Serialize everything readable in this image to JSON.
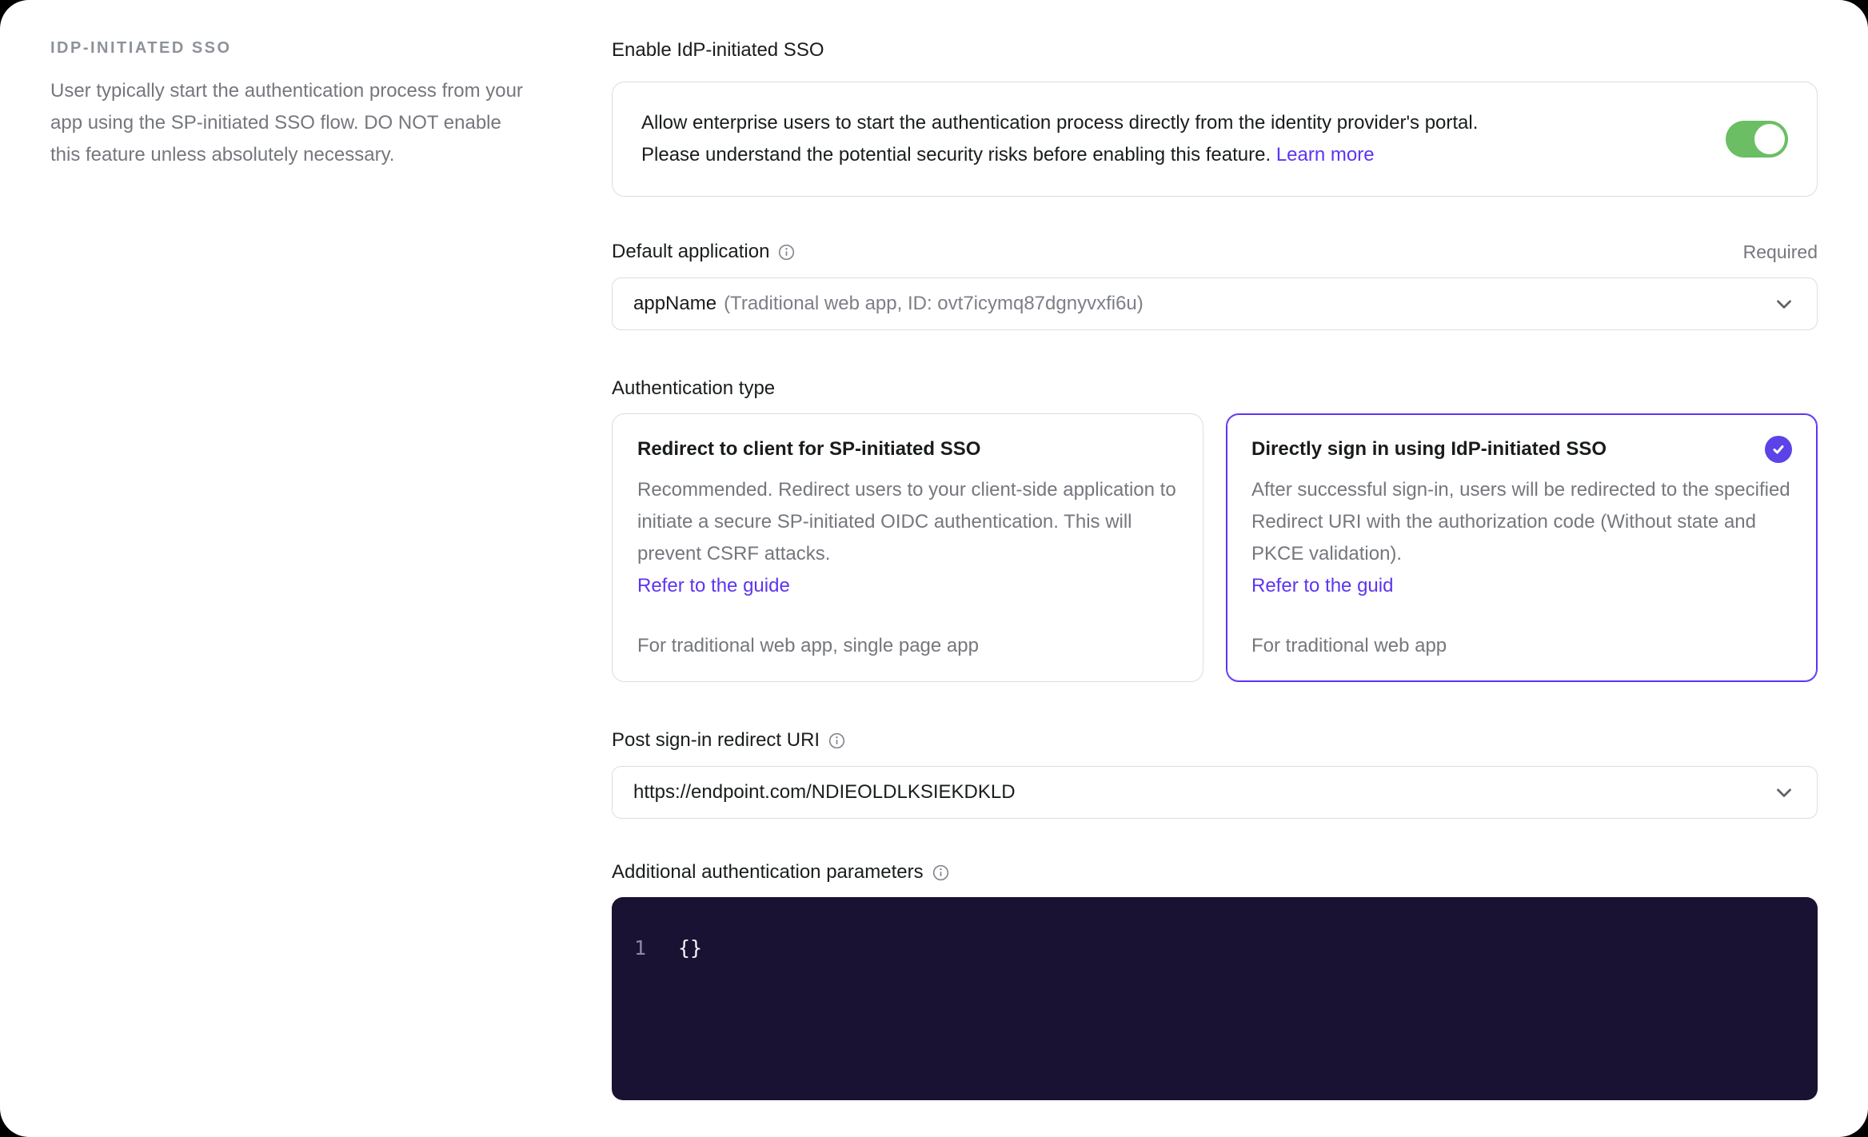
{
  "colors": {
    "accent": "#5d34f2",
    "toggle_on_green": "#6bbe64",
    "editor_background": "#1a1233",
    "muted_text": "#75777d",
    "border": "#dbdde2"
  },
  "icons": {
    "info": "info-circle-outline",
    "chevron": "chevron-down",
    "check": "checkmark"
  },
  "sidebar": {
    "title": "IDP-INITIATED SSO",
    "description": "User typically start the authentication process from your app using the SP-initiated SSO flow. DO NOT enable this feature unless absolutely necessary."
  },
  "enable_sso": {
    "label": "Enable IdP-initiated SSO",
    "description_lines": [
      "Allow enterprise users to start the authentication process directly from the identity provider's portal.",
      "Please understand the potential security risks before enabling this feature."
    ],
    "learn_more": "Learn more",
    "toggle_state": "on"
  },
  "default_application": {
    "label": "Default application",
    "required_tag": "Required",
    "selected_name": "appName",
    "selected_details": "(Traditional web app, ID: ovt7icymq87dgnyvxfi6u)"
  },
  "authentication_type": {
    "label": "Authentication type",
    "options": [
      {
        "title": "Redirect to client for SP-initiated SSO",
        "description": "Recommended. Redirect users to your client-side application to initiate a secure SP-initiated OIDC authentication. This will prevent CSRF attacks.",
        "link": "Refer to the guide",
        "footnote": "For traditional web app, single page app",
        "selected": false
      },
      {
        "title": "Directly sign in using IdP-initiated SSO",
        "description": "After successful sign-in, users will be redirected to the specified Redirect URI with the authorization code (Without state and PKCE validation).",
        "link": "Refer to the guid",
        "footnote": "For traditional web app",
        "selected": true
      }
    ]
  },
  "post_sign_in_redirect_uri": {
    "label": "Post sign-in redirect URI",
    "value": "https://endpoint.com/NDIEOLDLKSIEKDKLD"
  },
  "additional_parameters": {
    "label": "Additional authentication parameters",
    "lines": [
      {
        "number": "1",
        "code": "{}"
      }
    ]
  }
}
